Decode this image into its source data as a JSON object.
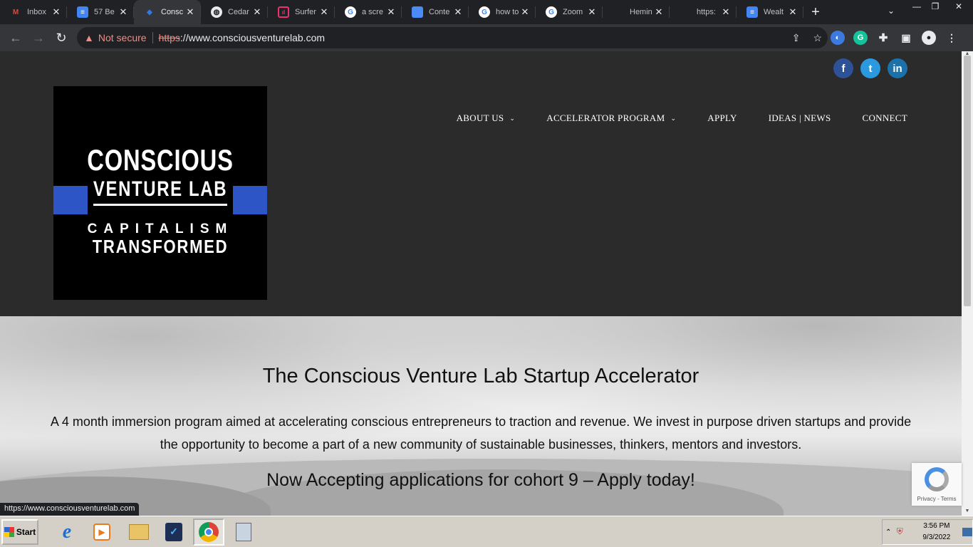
{
  "browser": {
    "tabs": [
      {
        "title": "Inbox",
        "icon": "gmail-icon",
        "color": "#ea4335"
      },
      {
        "title": "57 Be",
        "icon": "docs-icon",
        "color": "#4285f4"
      },
      {
        "title": "Consc",
        "icon": "site-icon",
        "color": "#2c7be5",
        "active": true
      },
      {
        "title": "Cedar",
        "icon": "globe-icon",
        "color": "#9aa0a6"
      },
      {
        "title": "Surfer",
        "icon": "surfer-icon",
        "color": "#e8336b"
      },
      {
        "title": "a scre",
        "icon": "google-icon",
        "color": "#4285f4"
      },
      {
        "title": "Conte",
        "icon": "docs-icon",
        "color": "#4a8bf5"
      },
      {
        "title": "how to",
        "icon": "google-icon",
        "color": "#4285f4"
      },
      {
        "title": "Zoom",
        "icon": "google-icon",
        "color": "#4285f4"
      },
      {
        "title": "Hemin",
        "icon": "blank-icon",
        "color": "#202124"
      },
      {
        "title": "https:",
        "icon": "blank-icon",
        "color": "#202124"
      },
      {
        "title": "Wealt",
        "icon": "docs-icon",
        "color": "#4285f4"
      }
    ],
    "address": {
      "security_label": "Not secure",
      "scheme": "https",
      "rest": "://www.consciousventurelab.com"
    },
    "status_url": "https://www.consciousventurelab.com"
  },
  "site": {
    "social": [
      {
        "label": "f",
        "name": "facebook-icon"
      },
      {
        "label": "t",
        "name": "twitter-icon"
      },
      {
        "label": "in",
        "name": "linkedin-icon"
      }
    ],
    "logo": {
      "line1": "CONSCIOUS",
      "line2": "VENTURE LAB",
      "line3": "CAPITALISM",
      "line4": "TRANSFORMED"
    },
    "nav": [
      {
        "label": "ABOUT US",
        "dropdown": true
      },
      {
        "label": "ACCELERATOR PROGRAM",
        "dropdown": true
      },
      {
        "label": "APPLY",
        "dropdown": false
      },
      {
        "label": "IDEAS | NEWS",
        "dropdown": false
      },
      {
        "label": "CONNECT",
        "dropdown": false
      }
    ],
    "hero": {
      "title": "The Conscious Venture Lab Startup Accelerator",
      "description": "A 4 month immersion program aimed at accelerating conscious entrepreneurs to traction and revenue. We invest in purpose driven startups and provide the opportunity to become a part of a new community of sustainable businesses, thinkers, mentors and investors.",
      "cta": "Now Accepting applications for cohort 9 – Apply today!"
    },
    "recaptcha": {
      "text": "Privacy - Terms"
    }
  },
  "taskbar": {
    "start_label": "Start",
    "clock_time": "3:56 PM",
    "clock_date": "9/3/2022"
  }
}
